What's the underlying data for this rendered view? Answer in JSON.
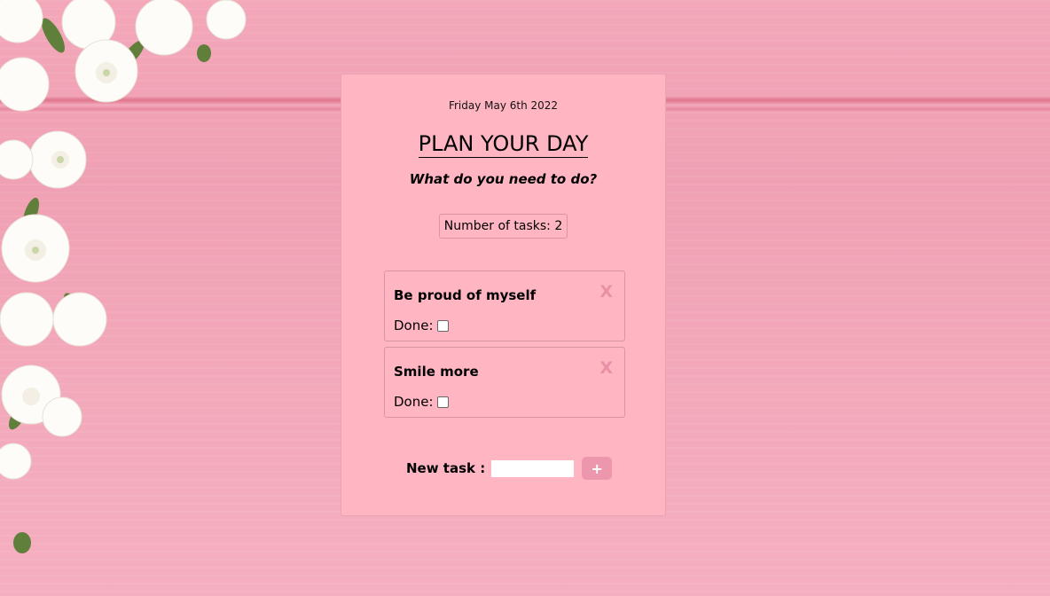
{
  "planner": {
    "date": "Friday May 6th 2022",
    "title": "PLAN YOUR DAY",
    "subtitle": "What do you need to do?",
    "task_count_label": "Number of tasks: 2",
    "tasks": [
      {
        "name": "Be proud of myself",
        "close_label": "X",
        "done_label": "Done:",
        "done": false
      },
      {
        "name": "Smile more",
        "close_label": "X",
        "done_label": "Done:",
        "done": false
      }
    ],
    "new_task_label": "New task :",
    "new_task_value": "",
    "add_button_label": "+"
  },
  "colors": {
    "card_background": "#ffb6c2",
    "accent": "#ec97ac",
    "close_icon": "#e98fa6",
    "background_wood": "#f0a0b3"
  }
}
